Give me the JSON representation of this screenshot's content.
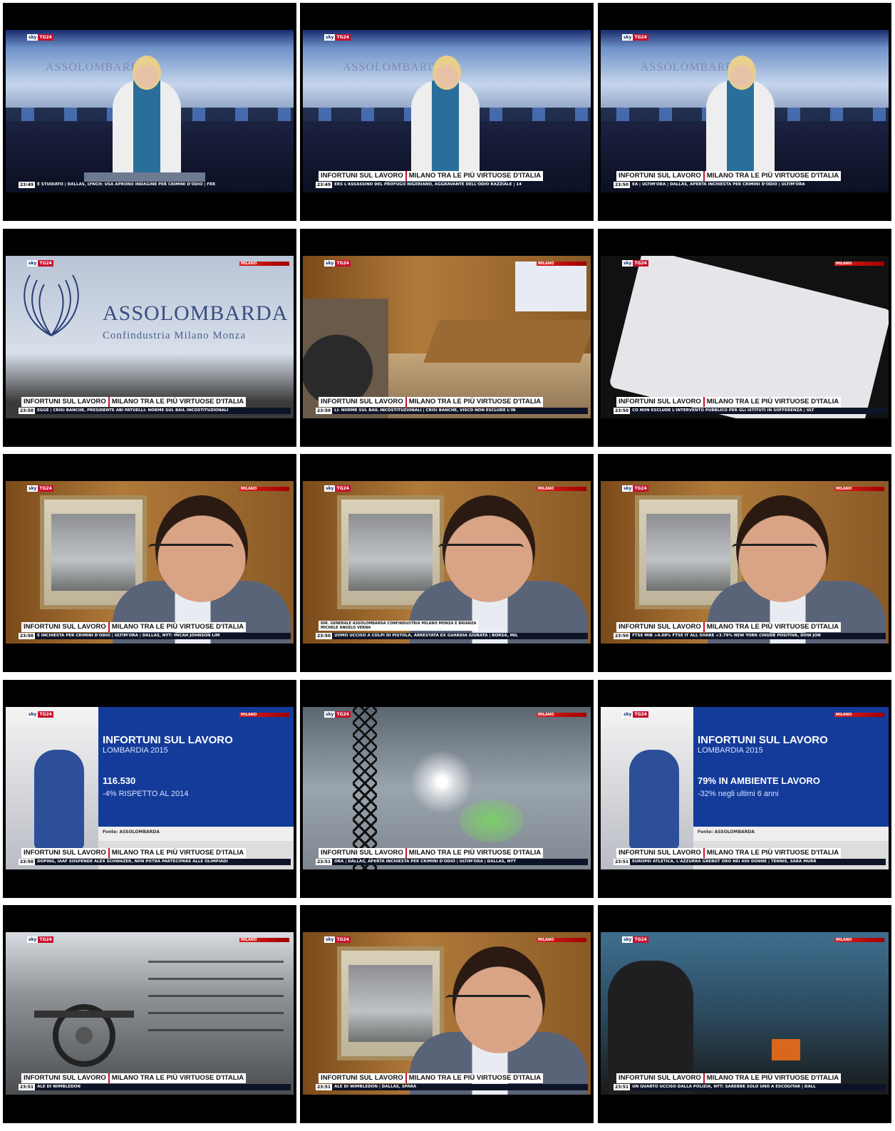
{
  "common": {
    "logo_sky": "sky",
    "logo_tg": "TG24",
    "location": "MILANO",
    "headline_left": "INFORTUNI SUL LAVORO",
    "headline_right": "MILANO TRA LE PIÙ VIRTUOSE D'ITALIA"
  },
  "frames": [
    {
      "time": "23:49",
      "ticker": "È STUDIATO | DALLAS, LYNCH: USA APRONO INDAGINE PER CRIMINI D'ODIO | FER"
    },
    {
      "time": "23:49",
      "ticker": "ERS L'ASSASSINO DEL PROFUGO NIGERIANO, AGGRAVANTE DELL'ODIO RAZZIALE | 14"
    },
    {
      "time": "23:50",
      "ticker": "EA | ULTIM'ORA | DALLAS, APERTA INCHIESTA PER CRIMINI D'ODIO | ULTIM'ORA"
    },
    {
      "time": "23:50",
      "ticker": "EGGE | CRISI BANCHE, PRESIDENTE ABI PATUELLI: NORME SUL BAIL INCOSTITUZIONALI"
    },
    {
      "time": "23:50",
      "ticker": "LI: NORME SUL BAIL INCOSTITUZIONALI | CRISI BANCHE, VISCO NON ESCLUDE L'IN"
    },
    {
      "time": "23:50",
      "ticker": "CO NON ESCLUDE L'INTERVENTO PUBBLICO PER GLI ISTITUTI IN SOFFERENZA | ULT"
    },
    {
      "time": "23:50",
      "ticker": "E INCHIESTA PER CRIMINI D'ODIO | ULTIM'ORA | DALLAS, NYT: MICAH JOHNSON LIM"
    },
    {
      "time": "23:50",
      "ticker": "UOMO UCCISO A COLPI DI PISTOLA, ARRESTATA EX GUARDIA GIURATA | BORSA, MIL"
    },
    {
      "time": "23:50",
      "ticker": "FTSE MIB +4.08% FTSE IT ALL SHARE +3.79% NEW YORK CHIUDE POSITIVA, DOW JON"
    },
    {
      "time": "23:50",
      "ticker": "DOPING, IAAF SOSPENDE ALEX SCHWAZER, NON POTRÀ PARTECIPARE ALLE OLIMPIADI"
    },
    {
      "time": "23:51",
      "ticker": "ORA | DALLAS, APERTA INCHIESTA PER CRIMINI D'ODIO | ULTIM'ORA | DALLAS, NYT"
    },
    {
      "time": "23:51",
      "ticker": "EUROPEI ATLETICA, L'AZZURRA GREBOT ORO NEI 400 DONNE | TENNIS, SARÀ MURR"
    },
    {
      "time": "23:51",
      "ticker": "ALE DI WIMBLEDON"
    },
    {
      "time": "23:51",
      "ticker": "ALE DI WIMBLEDON | DALLAS, SPARA"
    },
    {
      "time": "23:51",
      "ticker": "UN QUARTO UCCISO DALLA POLIZIA, NYT: SAREBBE SOLO UNO A ESCOGITAR | DALL"
    }
  ],
  "scene_text": {
    "wordmark_short": "ASSOLOMBARDA",
    "wordmark_big": "ASSOLOMBARDA",
    "wordmark_sub": "Confindustria Milano Monza",
    "caption_line1": "DIR. GENERALE ASSOLOMBARDA CONFINDUSTRIA MILANO MONZA E BRIANZA",
    "caption_line2": "MICHELE ANGELO VERNA"
  },
  "graphic1": {
    "title": "INFORTUNI SUL LAVORO",
    "subtitle": "LOMBARDIA 2015",
    "value": "116.530",
    "note": "-4% RISPETTO AL 2014",
    "source": "Fonte: ASSOLOMBARDA"
  },
  "graphic2": {
    "title": "INFORTUNI SUL LAVORO",
    "subtitle": "LOMBARDIA 2015",
    "value": "79% IN AMBIENTE LAVORO",
    "note": "-32% negli ultimi 6 anni",
    "source": "Fonte: ASSOLOMBARDA"
  }
}
